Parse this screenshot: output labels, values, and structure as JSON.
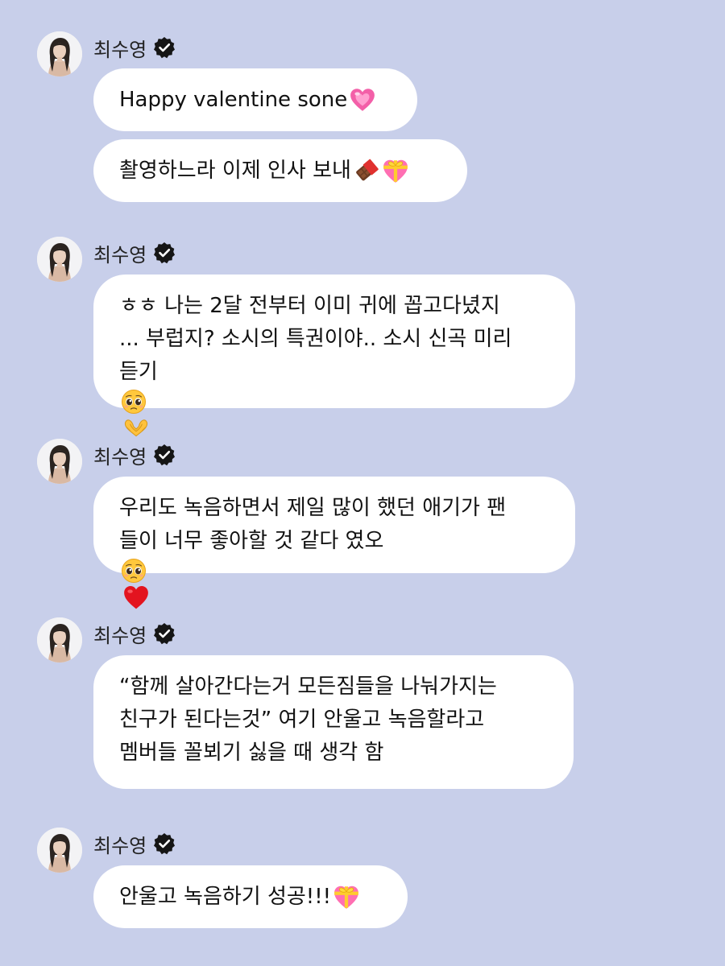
{
  "sender_name": "최수영",
  "groups": [
    {
      "messages": [
        {
          "lines": [
            "Happy valentine sone"
          ],
          "emoji": [
            "heart-icon"
          ]
        },
        {
          "lines": [
            "촬영하느라 이제 인사 보내"
          ],
          "emoji": [
            "chocolate-icon",
            "gift-heart-icon"
          ]
        }
      ]
    },
    {
      "messages": [
        {
          "lines": [
            "ㅎㅎ 나는 2달 전부터 이미 귀에 꼽고다녔지",
            "... 부럽지? 소시의 특권이야.. 소시 신곡 미리",
            "듣기 "
          ],
          "emoji": [
            "pleading-face-icon",
            "heart-hands-icon"
          ]
        }
      ]
    },
    {
      "messages": [
        {
          "lines": [
            "우리도 녹음하면서 제일 많이 했던 애기가 팬",
            "들이 너무 좋아할 것 같다 였오"
          ],
          "emoji": [
            "pleading-face-icon",
            "red-heart-icon"
          ]
        }
      ]
    },
    {
      "messages": [
        {
          "lines": [
            "“함께 살아간다는거 모든짐들을 나눠가지는",
            "친구가 된다는것” 여기 안울고 녹음할라고",
            "멤버들 꼴뵈기 싫을 때 생각 함"
          ],
          "emoji": []
        }
      ]
    },
    {
      "messages": [
        {
          "lines": [
            "안울고 녹음하기 성공!!! "
          ],
          "emoji": [
            "gift-heart-icon"
          ]
        }
      ]
    }
  ],
  "colors": {
    "background": "#c8cfea",
    "bubble": "#ffffff",
    "text": "#111111"
  }
}
